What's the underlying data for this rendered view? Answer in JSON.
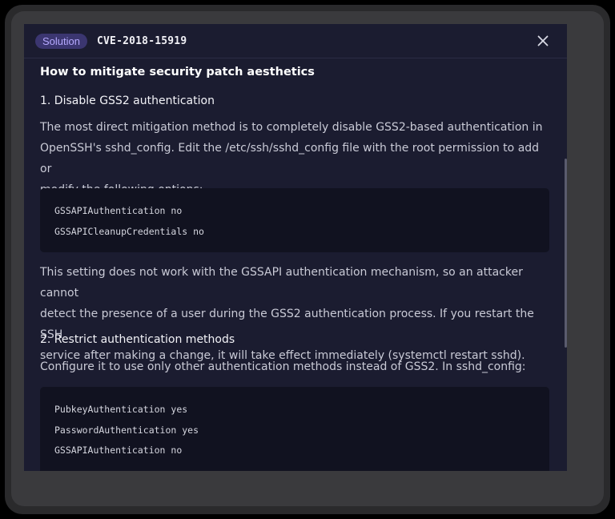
{
  "header": {
    "badge_label": "Solution",
    "cve_id": "CVE-2018-15919",
    "close_icon": "close-icon"
  },
  "content": {
    "title": "How to mitigate security patch aesthetics",
    "sections": [
      {
        "heading": "1. Disable GSS2 authentication",
        "intro_lines": [
          "The most direct mitigation method is to completely disable GSS2-based authentication in",
          "OpenSSH's sshd_config. Edit the /etc/ssh/sshd_config file with the root permission to add or",
          "modify the following options:"
        ],
        "code": [
          "GSSAPIAuthentication no",
          "GSSAPICleanupCredentials no"
        ],
        "outro_lines": [
          "This setting does not work with the GSSAPI authentication mechanism, so an attacker cannot",
          "detect the presence of a user during the GSS2 authentication process. If you restart the SSH",
          "service after making a change, it will take effect immediately (systemctl restart sshd)."
        ]
      },
      {
        "heading": "2. Restrict authentication methods",
        "intro_lines": [
          "Configure it to use only other authentication methods instead of GSS2. In sshd_config:"
        ],
        "code": [
          "PubkeyAuthentication yes",
          "PasswordAuthentication yes",
          "GSSAPIAuthentication no"
        ]
      }
    ]
  },
  "colors": {
    "modal_bg": "#1b1c30",
    "badge_bg": "#3b3670",
    "badge_text": "#b6a9ff",
    "code_bg": "#111220"
  }
}
